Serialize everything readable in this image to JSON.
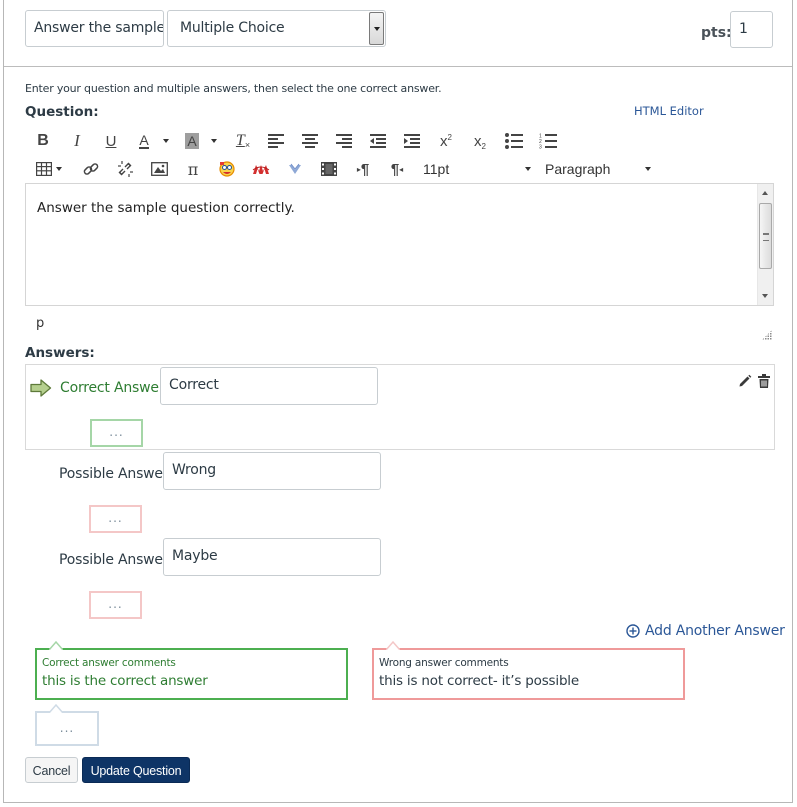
{
  "header": {
    "question_title": "Answer the sample",
    "question_type": "Multiple Choice",
    "points_label": "pts:",
    "points_value": "1"
  },
  "instructions": "Enter your question and multiple answers, then select the one correct answer.",
  "question_label": "Question:",
  "html_editor_link": "HTML Editor",
  "toolbar": {
    "row1": [
      "bold-icon",
      "italic-icon",
      "underline-icon",
      "text-color-icon",
      "dropdown-caret",
      "background-color-icon",
      "dropdown-caret",
      "clear-formatting-icon",
      "align-left-icon",
      "align-center-icon",
      "align-right-icon",
      "outdent-icon",
      "indent-icon",
      "superscript-icon",
      "subscript-icon",
      "bullet-list-icon",
      "numbered-list-icon"
    ],
    "row2": [
      "table-icon",
      "link-icon",
      "unlink-icon",
      "image-icon",
      "math-pi-icon",
      "lti-app-icon",
      "mcgraw-hill-icon",
      "vimeo-v-icon",
      "media-icon",
      "ltr-paragraph-icon",
      "rtl-paragraph-icon"
    ],
    "font_size": "11pt",
    "block_format": "Paragraph"
  },
  "editor": {
    "content": "Answer the sample question correctly.",
    "status_path": "p"
  },
  "answers_label": "Answers:",
  "answers": [
    {
      "label": "Correct Answer",
      "value": "Correct",
      "is_correct": true,
      "comment_button": "..."
    },
    {
      "label": "Possible Answer",
      "value": "Wrong",
      "is_correct": false,
      "comment_button": "..."
    },
    {
      "label": "Possible Answer",
      "value": "Maybe",
      "is_correct": false,
      "comment_button": "..."
    }
  ],
  "add_answer_label": "Add Another Answer",
  "comments": {
    "correct": {
      "title": "Correct answer comments",
      "body": "this is the correct answer"
    },
    "wrong": {
      "title": "Wrong answer comments",
      "body": "this is not correct- it’s possible"
    },
    "general_button": "..."
  },
  "buttons": {
    "cancel": "Cancel",
    "update": "Update Question"
  },
  "colors": {
    "correct_green": "#2e7d32",
    "wrong_red": "#ef9a9a",
    "link_blue": "#2b5797",
    "primary_button": "#0e3466"
  }
}
